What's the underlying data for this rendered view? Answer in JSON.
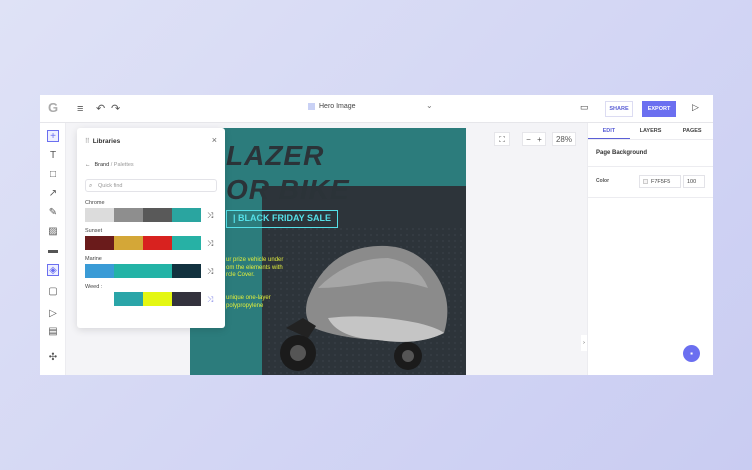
{
  "topbar": {
    "document_title": "Hero Image",
    "share_label": "SHARE",
    "export_label": "EXPORT"
  },
  "zoom": {
    "minus": "−",
    "plus": "+",
    "level": "28%"
  },
  "libraries": {
    "title": "Libraries",
    "breadcrumb_parent": "Brand",
    "breadcrumb_sep": " / ",
    "breadcrumb_current": "Palettes",
    "search_placeholder": "Quick find",
    "palettes": [
      {
        "name": "Chrome",
        "colors": [
          "#dcdcdc",
          "#8e8e8e",
          "#595959",
          "#2aa5a0"
        ]
      },
      {
        "name": "Sunset",
        "colors": [
          "#6a1b1b",
          "#d4a737",
          "#d8221f",
          "#27b1a5"
        ]
      },
      {
        "name": "Marine",
        "colors": [
          "#3a9bd6",
          "#23b3a6",
          "#23b3a6",
          "#12323f"
        ]
      },
      {
        "name": "Weed :",
        "colors": [
          "#ffffff",
          "#2aa5a8",
          "#e4f712",
          "#33323d"
        ]
      }
    ]
  },
  "canvas_text": {
    "line1": "LAZER",
    "line2": "OR BIKE",
    "sale": "| BLACK FRIDAY SALE",
    "p1": [
      "ur prize vehicle under",
      "om the elements with",
      "rcle Cover."
    ],
    "p2": [
      "unique one-layer",
      "polypropylene"
    ]
  },
  "right_panel": {
    "tabs": [
      "EDIT",
      "LAYERS",
      "PAGES"
    ],
    "section_title": "Page Background",
    "color_label": "Color",
    "color_hex": "F7F5F5",
    "opacity": "100"
  }
}
